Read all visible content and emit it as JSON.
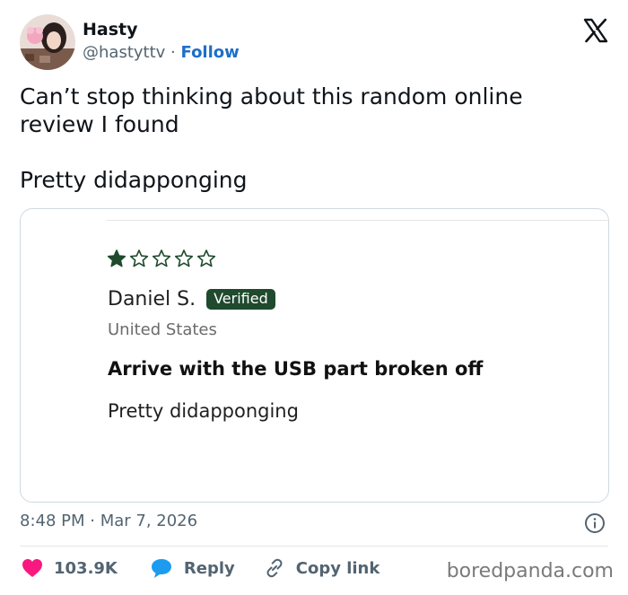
{
  "author": {
    "name": "Hasty",
    "handle": "@hastyttv",
    "separator": "·",
    "follow_label": "Follow"
  },
  "tweet": {
    "line1": "Can’t stop thinking about this random online review I found",
    "line2": "Pretty didapponging"
  },
  "review": {
    "rating": 1,
    "max_rating": 5,
    "reviewer_name": "Daniel S.",
    "verified_label": "Verified",
    "country": "United States",
    "title": "Arrive with the USB part broken off",
    "body": "Pretty didapponging"
  },
  "meta": {
    "timestamp": "8:48 PM · Mar 7, 2026"
  },
  "actions": {
    "likes": "103.9K",
    "reply_label": "Reply",
    "copy_link_label": "Copy link"
  },
  "watermark": "boredpanda.com",
  "colors": {
    "follow": "#1d6fc9",
    "heart": "#f91880",
    "reply_bubble": "#1d9bf0",
    "star": "#1f4a2e",
    "verified_badge": "#1f4a2e"
  },
  "icons": [
    "x-logo-icon",
    "star-filled-icon",
    "star-outline-icon",
    "info-icon",
    "heart-icon",
    "reply-icon",
    "link-icon"
  ]
}
